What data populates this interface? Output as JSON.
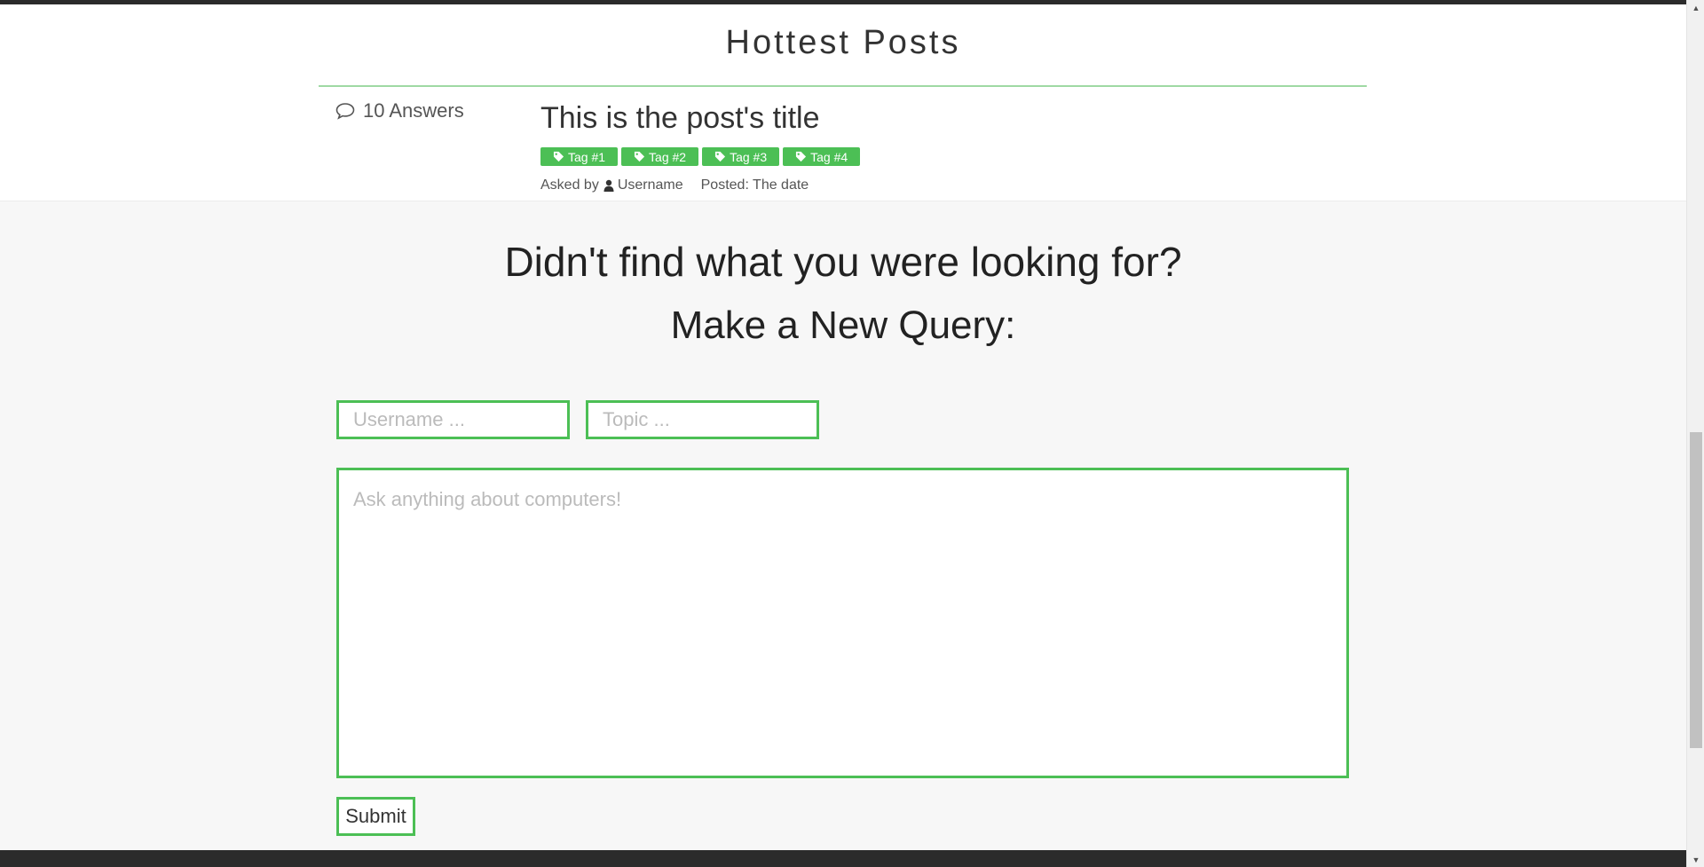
{
  "posts": {
    "section_title": "Hottest Posts",
    "items": [
      {
        "answers": "10 Answers",
        "title": "This is the post's title",
        "tags": [
          "Tag #1",
          "Tag #2",
          "Tag #3",
          "Tag #4"
        ],
        "asked_by_label": "Asked by",
        "username": "Username",
        "posted": "Posted: The date"
      }
    ]
  },
  "query": {
    "heading_line1": "Didn't find what you were looking for?",
    "heading_line2": "Make a New Query:",
    "username_placeholder": "Username ...",
    "topic_placeholder": "Topic ...",
    "question_placeholder": "Ask anything about computers!",
    "submit_label": "Submit"
  },
  "icons": {
    "answers": "comment-icon",
    "tag": "tag-icon",
    "user": "user-icon"
  },
  "colors": {
    "accent": "#4cbf55",
    "rule": "#9fd9a3",
    "bar": "#2b2b2b"
  }
}
